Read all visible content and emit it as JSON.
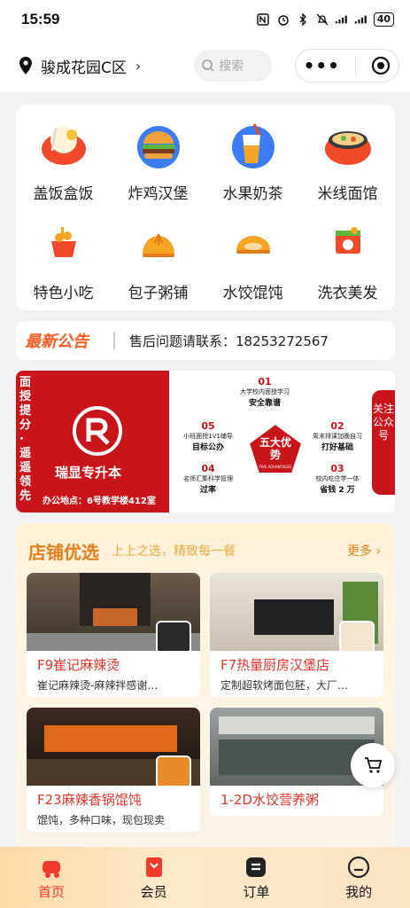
{
  "status": {
    "time": "15:59",
    "battery": "40"
  },
  "header": {
    "location": "骏成花园C区",
    "search_placeholder": "搜索"
  },
  "categories": [
    {
      "label": "盖饭盒饭",
      "icon": "rice-bowl-icon"
    },
    {
      "label": "炸鸡汉堡",
      "icon": "burger-icon"
    },
    {
      "label": "水果奶茶",
      "icon": "milk-tea-icon"
    },
    {
      "label": "米线面馆",
      "icon": "noodle-bowl-icon"
    },
    {
      "label": "特色小吃",
      "icon": "snack-icon"
    },
    {
      "label": "包子粥铺",
      "icon": "bun-icon"
    },
    {
      "label": "水饺馄饨",
      "icon": "dumpling-icon"
    },
    {
      "label": "洗衣美发",
      "icon": "laundry-icon"
    }
  ],
  "notice": {
    "tag": "最新公告",
    "text": "售后问题请联系：18253272567"
  },
  "banner": {
    "vertical_text": "面授提分·遥遥领先",
    "brand": "瑞显专升本",
    "address": "办公地点：6号教学楼412室",
    "center": "五大优势",
    "center_sub": "FIVE ADVANTAGES",
    "items": [
      {
        "num": "01",
        "title": "大学校内面授学习",
        "sub": "安全靠谱"
      },
      {
        "num": "02",
        "title": "周末排课加晚自习",
        "sub": "打好基础"
      },
      {
        "num": "03",
        "title": "校内吃住学一体",
        "sub": "省钱 2 万"
      },
      {
        "num": "04",
        "title": "名师汇集科学管理",
        "sub": "过率"
      },
      {
        "num": "05",
        "title": "小班面授1V1辅导",
        "sub": "目标公办"
      }
    ],
    "side": "关注公众号"
  },
  "shops": {
    "title": "店铺优选",
    "subtitle": "上上之选，精致每一餐",
    "more": "更多",
    "items": [
      {
        "name": "F9崔记麻辣烫",
        "desc": "崔记麻辣烫-麻辣拌感谢…"
      },
      {
        "name": "F7热量厨房汉堡店",
        "desc": "定制超软烤面包胚，大厂…"
      },
      {
        "name": "F23麻辣香锅馄饨",
        "desc": "馄饨，多种口味，现包现卖"
      },
      {
        "name": "1-2D水饺营养粥",
        "desc": ""
      }
    ]
  },
  "tabs": [
    {
      "label": "首页"
    },
    {
      "label": "会员"
    },
    {
      "label": "订单"
    },
    {
      "label": "我的"
    }
  ],
  "colors": {
    "accent": "#ef3a2c",
    "notice": "#ff5a1f",
    "shop_title": "#e67e1e",
    "banner_red": "#c8141b"
  }
}
